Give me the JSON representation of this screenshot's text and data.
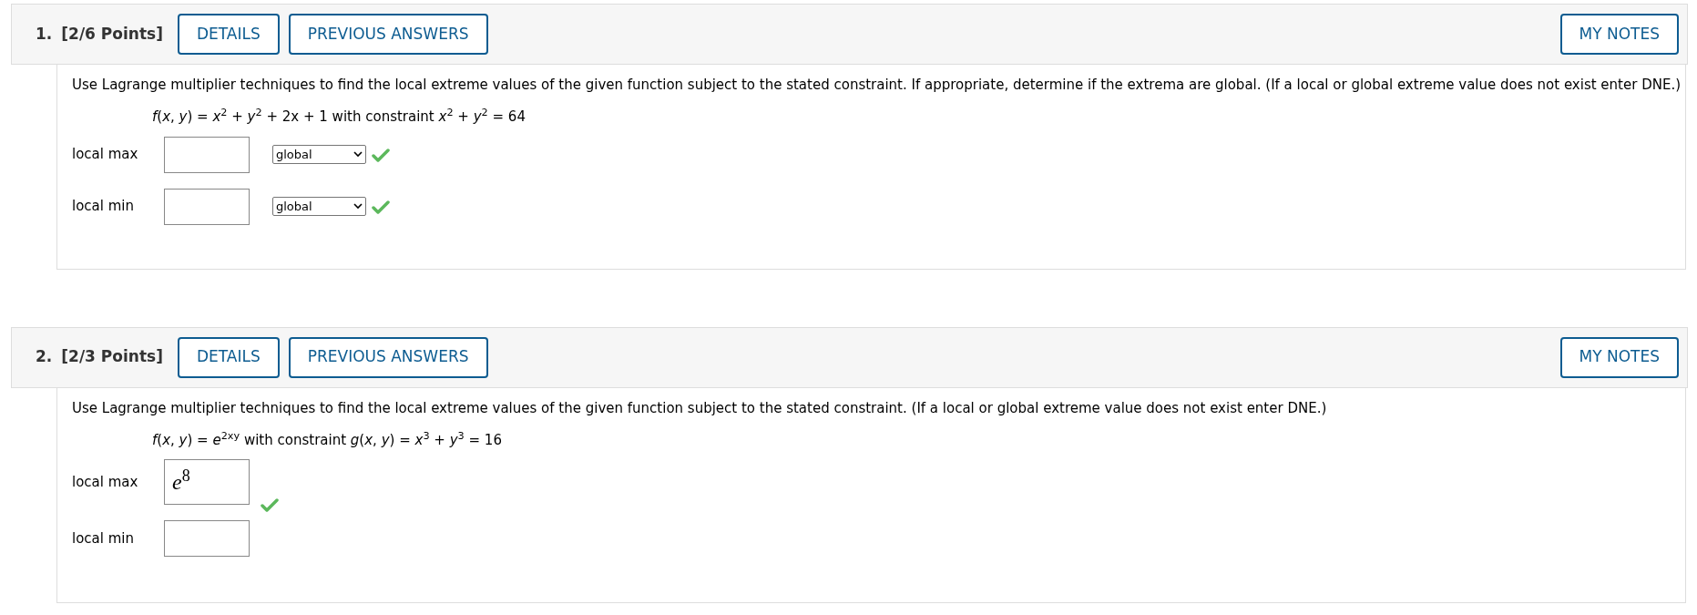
{
  "questions": [
    {
      "number": "1.",
      "points": "[2/6 Points]",
      "buttons": [
        "DETAILS",
        "PREVIOUS ANSWERS"
      ],
      "notes_button": "MY NOTES",
      "prompt": "Use Lagrange multiplier techniques to find the local extreme values of the given function subject to the stated constraint. If appropriate, determine if the extrema are global. (If a local or global extreme value does not exist enter DNE.)",
      "formula": "*f*(*x*, *y*) = *x*$^{2}$ + *y*$^{2}$ + 2x + 1 with constraint *x*$^{2}$ + *y*$^{2}$ = 64",
      "answers": [
        {
          "label": "local max",
          "select": "global",
          "correct": true
        },
        {
          "label": "local min",
          "select": "global",
          "correct": true
        }
      ]
    },
    {
      "number": "2.",
      "points": "[2/3 Points]",
      "buttons": [
        "DETAILS",
        "PREVIOUS ANSWERS"
      ],
      "notes_button": "MY NOTES",
      "prompt": "Use Lagrange multiplier techniques to find the local extreme values of the given function subject to the stated constraint. (If a local or global extreme value does not exist enter DNE.)",
      "formula": "*f*(*x*, *y*) = *e*$^{2xy}$ with constraint *g*(*x*, *y*) = *x*$^{3}$ + *y*$^{3}$ = 16",
      "answers": [
        {
          "label": "local max",
          "value": "*e*$^{8}$",
          "correct": true
        },
        {
          "label": "local min",
          "correct": false
        }
      ]
    }
  ]
}
